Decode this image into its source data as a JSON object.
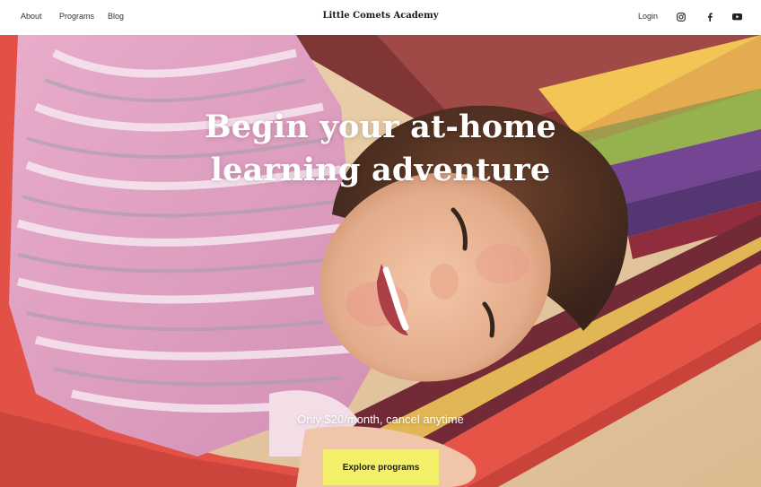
{
  "nav": {
    "links": [
      "About",
      "Programs",
      "Blog"
    ],
    "brand": "Little Comets Academy",
    "login": "Login",
    "social_icons": [
      "instagram-icon",
      "facebook-icon",
      "youtube-icon"
    ]
  },
  "hero": {
    "title_line1": "Begin your at-home",
    "title_line2": "learning adventure",
    "subtitle": "Only $20/month, cancel anytime",
    "cta_label": "Explore programs"
  },
  "colors": {
    "cta_background": "#f3f06a",
    "nav_background": "#ffffff",
    "hero_text": "#ffffff"
  }
}
